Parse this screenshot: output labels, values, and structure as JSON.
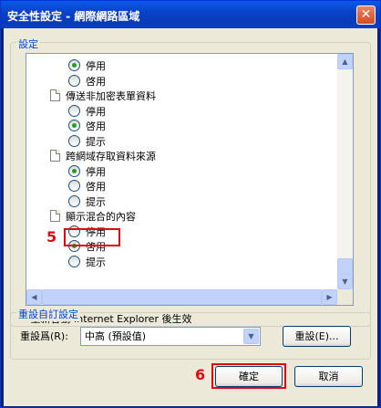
{
  "window": {
    "title": "安全性設定 - 網際網路區域",
    "close_glyph": "✕"
  },
  "settings_group": {
    "legend": "設定",
    "items": [
      {
        "type": "radio",
        "label": "停用",
        "checked": true,
        "indent": 1
      },
      {
        "type": "radio",
        "label": "啓用",
        "checked": false,
        "indent": 1
      },
      {
        "type": "header",
        "label": "傳送非加密表單資料",
        "icon": "document-icon"
      },
      {
        "type": "radio",
        "label": "停用",
        "checked": false,
        "indent": 1
      },
      {
        "type": "radio",
        "label": "啓用",
        "checked": true,
        "indent": 1
      },
      {
        "type": "radio",
        "label": "提示",
        "checked": false,
        "indent": 1
      },
      {
        "type": "header",
        "label": "跨網域存取資料來源",
        "icon": "document-icon"
      },
      {
        "type": "radio",
        "label": "停用",
        "checked": true,
        "indent": 1
      },
      {
        "type": "radio",
        "label": "啓用",
        "checked": false,
        "indent": 1
      },
      {
        "type": "radio",
        "label": "提示",
        "checked": false,
        "indent": 1
      },
      {
        "type": "header",
        "label": "顯示混合的內容",
        "icon": "document-icon"
      },
      {
        "type": "radio",
        "label": "停用",
        "checked": false,
        "indent": 1
      },
      {
        "type": "radio",
        "label": "啓用",
        "checked": true,
        "indent": 1
      },
      {
        "type": "radio",
        "label": "提示",
        "checked": false,
        "indent": 1
      }
    ],
    "restart_note": "*重新啓動 Internet Explorer 後生效"
  },
  "reset_group": {
    "legend": "重設自訂設定",
    "reset_to_label": "重設爲(R):",
    "reset_to_value": "中高 (預設值)",
    "reset_button": "重設(E)..."
  },
  "footer": {
    "ok_button": "確定",
    "cancel_button": "取消"
  },
  "annotations": {
    "step5": "5",
    "step6": "6"
  },
  "colors": {
    "annotation": "#e30613",
    "legend_text": "#0046d5",
    "title_bar": "#0a42c9"
  }
}
